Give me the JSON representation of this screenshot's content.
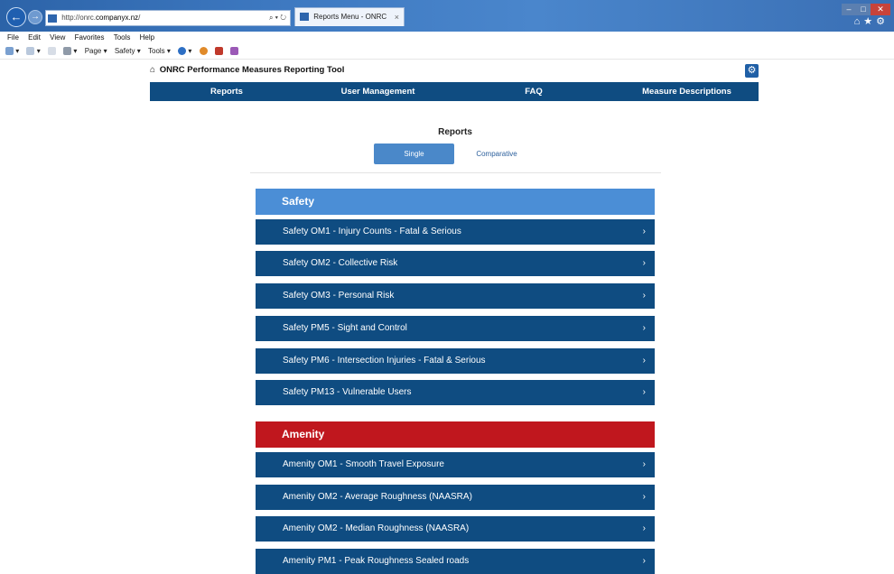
{
  "browser": {
    "address_url_prefix": "http://onrc.",
    "address_url_domain": "companyx.nz",
    "address_url_suffix": "/",
    "address_tools": "⌕ ▾ ↻",
    "tab_title": "Reports Menu - ONRC Perf...",
    "tab_close": "×",
    "menu": [
      "File",
      "Edit",
      "View",
      "Favorites",
      "Tools",
      "Help"
    ],
    "commands": [
      "Page ▾",
      "Safety ▾",
      "Tools ▾"
    ]
  },
  "app": {
    "title": "ONRC Performance Measures Reporting Tool",
    "nav": [
      "Reports",
      "User Management",
      "FAQ",
      "Measure Descriptions"
    ]
  },
  "reports": {
    "heading": "Reports",
    "toggle_single": "Single",
    "toggle_comparative": "Comparative"
  },
  "sections": {
    "safety": {
      "title": "Safety",
      "items": [
        "Safety OM1 - Injury Counts - Fatal & Serious",
        "Safety OM2 - Collective Risk",
        "Safety OM3 - Personal Risk",
        "Safety PM5 - Sight and Control",
        "Safety PM6 - Intersection Injuries - Fatal & Serious",
        "Safety PM13 - Vulnerable Users"
      ]
    },
    "amenity": {
      "title": "Amenity",
      "items": [
        "Amenity OM1 - Smooth Travel Exposure",
        "Amenity OM2 - Average Roughness (NAASRA)",
        "Amenity OM2 - Median Roughness (NAASRA)",
        "Amenity PM1 - Peak Roughness Sealed roads"
      ]
    }
  },
  "colors": {
    "nav_bg": "#0f4c81",
    "safety_header": "#4b8ed6",
    "amenity_header": "#c0171e",
    "toggle_active": "#4a88c9"
  }
}
